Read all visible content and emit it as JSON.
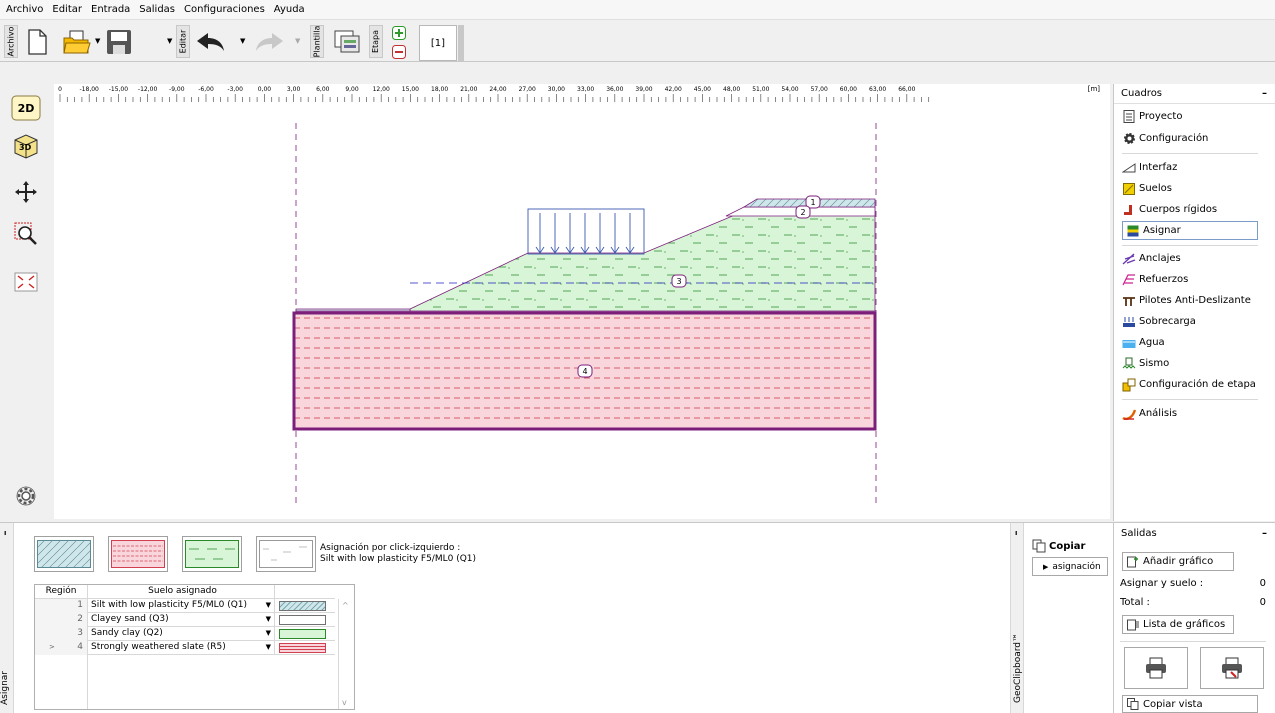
{
  "menubar": {
    "items": [
      "Archivo",
      "Editar",
      "Entrada",
      "Salidas",
      "Configuraciones",
      "Ayuda"
    ]
  },
  "toolbar": {
    "group_archivo": "Archivo",
    "group_editar": "Editar",
    "group_plantilla": "Plantilla",
    "group_etapa": "Etapa",
    "stage_label": "[1]"
  },
  "left_tools": {
    "view_2d": "2D",
    "view_3d": "3D"
  },
  "ruler": {
    "unit": "[m]",
    "ticks": [
      "0",
      "-18,00",
      "-15,00",
      "-12,00",
      "-9,00",
      "-6,00",
      "-3,00",
      "0,00",
      "3,00",
      "6,00",
      "9,00",
      "12,00",
      "15,00",
      "18,00",
      "21,00",
      "24,00",
      "27,00",
      "30,00",
      "33,00",
      "36,00",
      "39,00",
      "42,00",
      "45,00",
      "48,00",
      "51,00",
      "54,00",
      "57,00",
      "60,00",
      "63,00",
      "66,00"
    ]
  },
  "canvas": {
    "region_labels": [
      "1",
      "2",
      "3",
      "4"
    ]
  },
  "colors": {
    "soil_silt": "#cfe6ea",
    "soil_clayey_sand": "#ffffff",
    "soil_sandy_clay": "#d8f5d8",
    "soil_slate": "#f9d6dc",
    "outline": "#7b1f7b",
    "panel_bg": "#f0f0f0"
  },
  "cuadros": {
    "title": "Cuadros",
    "collapse": "–",
    "items": [
      {
        "label": "Proyecto",
        "icon": "document-icon"
      },
      {
        "label": "Configuración",
        "icon": "gear-icon"
      },
      {
        "label": "Interfaz",
        "icon": "interface-icon"
      },
      {
        "label": "Suelos",
        "icon": "soil-icon"
      },
      {
        "label": "Cuerpos rígidos",
        "icon": "rigid-body-icon"
      },
      {
        "label": "Asignar",
        "icon": "assign-icon"
      },
      {
        "label": "Anclajes",
        "icon": "anchor-icon"
      },
      {
        "label": "Refuerzos",
        "icon": "reinforcement-icon"
      },
      {
        "label": "Pilotes Anti-Deslizante",
        "icon": "pile-icon"
      },
      {
        "label": "Sobrecarga",
        "icon": "surcharge-icon"
      },
      {
        "label": "Agua",
        "icon": "water-icon"
      },
      {
        "label": "Sismo",
        "icon": "earthquake-icon"
      },
      {
        "label": "Configuración de etapa",
        "icon": "stage-settings-icon"
      },
      {
        "label": "Análisis",
        "icon": "analysis-icon"
      }
    ]
  },
  "assign_panel": {
    "side_label": "Asignar",
    "hint_line1": "Asignación por click-izquierdo :",
    "hint_line2": "Silt with low plasticity F5/ML0 (Q1)",
    "col_region": "Región",
    "col_soil": "Suelo asignado",
    "rows": [
      {
        "region": "1",
        "soil": "Silt with low plasticity F5/ML0 (Q1)"
      },
      {
        "region": "2",
        "soil": "Clayey sand (Q3)"
      },
      {
        "region": "3",
        "soil": "Sandy clay (Q2)"
      },
      {
        "region": "4",
        "soil": "Strongly weathered slate (R5)"
      }
    ]
  },
  "clipboard": {
    "side_label": "GeoClipboard™",
    "copy_label": "Copiar",
    "assign_button": "asignación"
  },
  "salidas": {
    "title": "Salidas",
    "collapse": "–",
    "add_graph": "Añadir gráfico",
    "assign_soil_label": "Asignar y suelo :",
    "assign_soil_value": "0",
    "total_label": "Total :",
    "total_value": "0",
    "graph_list": "Lista de gráficos",
    "copy_view": "Copiar vista"
  }
}
